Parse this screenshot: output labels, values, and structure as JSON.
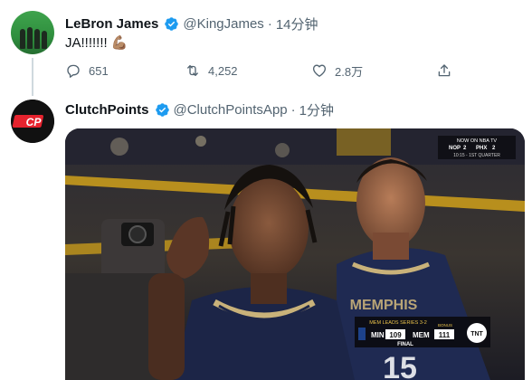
{
  "tweet1": {
    "name": "LeBron James",
    "handle": "@KingJames",
    "separator": "·",
    "time": "14分钟",
    "text": "JA!!!!!!!",
    "emoji": "💪🏽",
    "actions": {
      "reply_count": "651",
      "retweet_count": "4,252",
      "like_count": "2.8万"
    }
  },
  "tweet2": {
    "name": "ClutchPoints",
    "handle": "@ClutchPointsApp",
    "separator": "·",
    "time": "1分钟",
    "avatar_text": "CP",
    "media": {
      "network_label": "NOW ON NBA TV",
      "game_score": {
        "team1": "NOP",
        "score1": "2",
        "team2": "PHX",
        "score2": "2",
        "status": "10:15 - 1ST QUARTER"
      },
      "final_score": {
        "series_label": "MEM LEADS SERIES 3-2",
        "team1": "MIN",
        "score1": "109",
        "team2": "MEM",
        "score2": "111",
        "status": "FINAL",
        "bonus": "BONUS",
        "logo": "TNT"
      },
      "banner_text": "MEMPHIS",
      "jersey_number": "15"
    }
  },
  "colors": {
    "verified_blue": "#1d9bf0",
    "secondary_text": "#536471",
    "thread_line": "#cfd9de"
  }
}
